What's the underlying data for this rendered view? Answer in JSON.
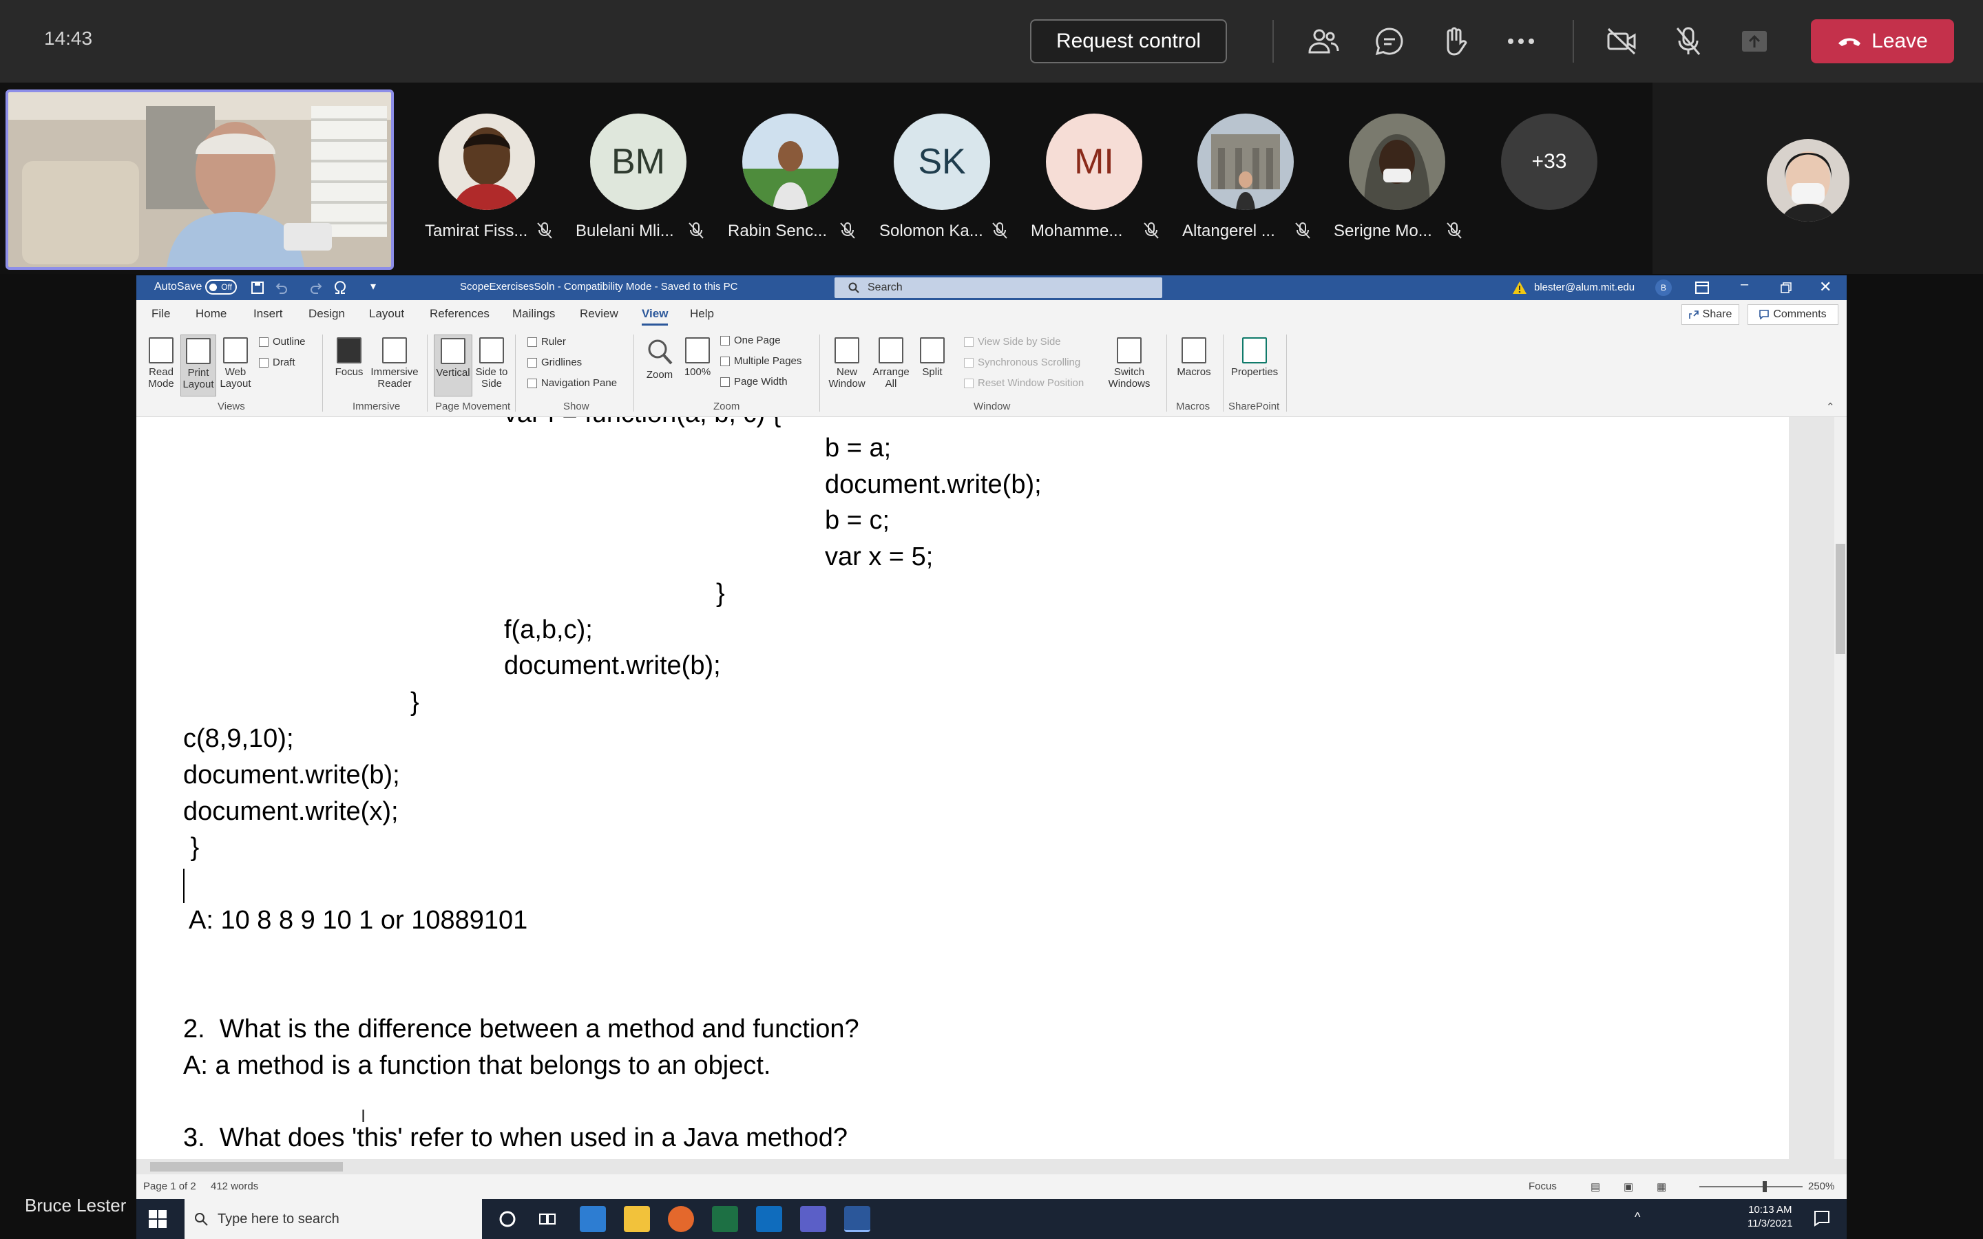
{
  "meeting": {
    "clock": "14:43",
    "request_control": "Request control",
    "leave": "Leave",
    "presenter_name": "Bruce Lester",
    "colors": {
      "leave": "#c4314b",
      "topbar": "#292929",
      "self_border": "#8d8ee8"
    }
  },
  "participants": [
    {
      "name": "Tamirat Fiss...",
      "initials": "",
      "bg": "#6b4a2b"
    },
    {
      "name": "Bulelani Mli...",
      "initials": "BM",
      "bg": "#dfe7dc",
      "fg": "#2f3b2f"
    },
    {
      "name": "Rabin Senc...",
      "initials": "",
      "bg": "#7aa2c7"
    },
    {
      "name": "Solomon Ka...",
      "initials": "SK",
      "bg": "#d9e6ec",
      "fg": "#1f3d4d"
    },
    {
      "name": "Mohamme...",
      "initials": "MI",
      "bg": "#f6ddd6",
      "fg": "#8a2a1a"
    },
    {
      "name": "Altangerel ...",
      "initials": "",
      "bg": "#8f9aa6"
    },
    {
      "name": "Serigne Mo...",
      "initials": "",
      "bg": "#5c5a52"
    }
  ],
  "more_participants": "+33",
  "word": {
    "autosave": "AutoSave",
    "autosave_state": "Off",
    "doc_title": "ScopeExercisesSoln  -  Compatibility Mode  -  Saved to this PC",
    "search": "Search",
    "account": "blester@alum.mit.edu",
    "account_initial": "B",
    "tabs": [
      "File",
      "Home",
      "Insert",
      "Design",
      "Layout",
      "References",
      "Mailings",
      "Review",
      "View",
      "Help"
    ],
    "active_tab": "View",
    "share": "Share",
    "comments": "Comments",
    "ribbon": {
      "read_mode": "Read Mode",
      "print_layout": "Print Layout",
      "web_layout": "Web Layout",
      "outline": "Outline",
      "draft": "Draft",
      "views": "Views",
      "focus": "Focus",
      "immersive_reader": "Immersive Reader",
      "immersive": "Immersive",
      "vertical": "Vertical",
      "side_to_side": "Side to Side",
      "page_movement": "Page Movement",
      "ruler": "Ruler",
      "gridlines": "Gridlines",
      "navigation_pane": "Navigation Pane",
      "show": "Show",
      "zoom": "Zoom",
      "hundred": "100%",
      "one_page": "One Page",
      "multiple_pages": "Multiple Pages",
      "page_width": "Page Width",
      "zoom_group": "Zoom",
      "new_window": "New Window",
      "arrange_all": "Arrange All",
      "split": "Split",
      "view_side_by_side": "View Side by Side",
      "sync_scrolling": "Synchronous Scrolling",
      "reset_window": "Reset Window Position",
      "switch_windows": "Switch Windows",
      "window": "Window",
      "macros": "Macros",
      "macros_group": "Macros",
      "properties": "Properties",
      "sharepoint": "SharePoint"
    },
    "doc_lines": [
      "var f = function(a, b, c) {",
      "b = a;",
      "document.write(b);",
      "b = c;",
      "var x = 5;",
      "}",
      "f(a,b,c);",
      "document.write(b);",
      "}",
      "c(8,9,10);",
      "document.write(b);",
      "document.write(x);",
      " }",
      "A: 10 8 8 9 10 1 or 10889101",
      "2.  What is the difference between a method and function?",
      "A: a method is a function that belongs to an object.",
      "3.  What does 'this' refer to when used in a Java method?"
    ],
    "status_page": "Page 1 of 2",
    "status_words": "412 words",
    "status_focus": "Focus",
    "zoom_level": "250%"
  },
  "taskbar": {
    "search_placeholder": "Type here to search",
    "time": "10:13 AM",
    "date": "11/3/2021"
  }
}
